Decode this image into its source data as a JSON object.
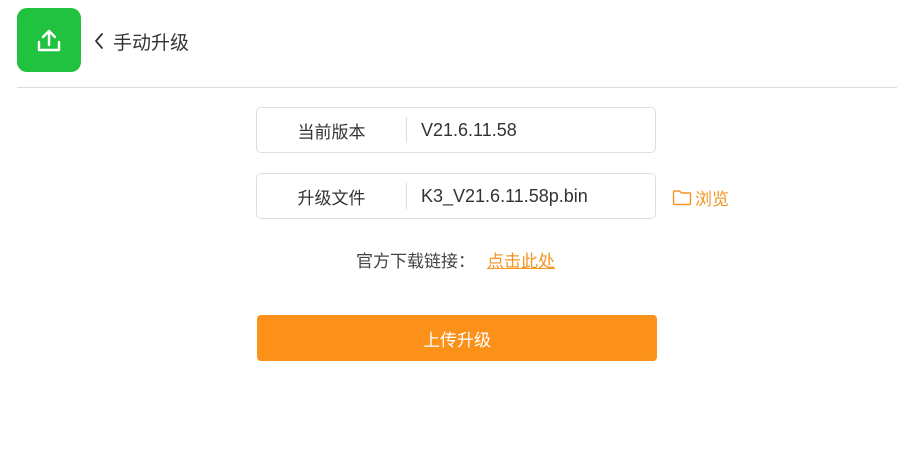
{
  "header": {
    "app_icon": "upload-icon",
    "back_icon": "chevron-left-icon",
    "title": "手动升级"
  },
  "form": {
    "current_version": {
      "label": "当前版本",
      "value": "V21.6.11.58"
    },
    "upgrade_file": {
      "label": "升级文件",
      "value": "K3_V21.6.11.58p.bin"
    },
    "browse": {
      "icon": "folder-icon",
      "label": "浏览"
    }
  },
  "download": {
    "label": "官方下载链接：",
    "link_text": "点击此处"
  },
  "actions": {
    "upload_label": "上传升级"
  },
  "colors": {
    "brand_green": "#22c241",
    "accent_orange": "#fb9119",
    "link_orange": "#f39423",
    "border": "#dedede"
  }
}
